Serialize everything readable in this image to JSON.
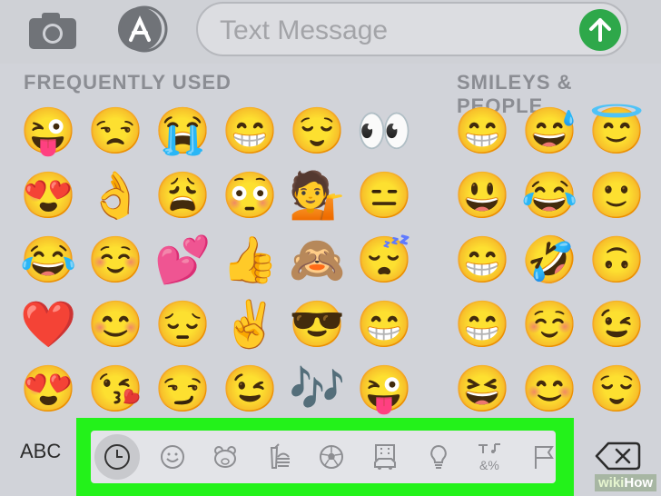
{
  "composer": {
    "placeholder": "Text Message",
    "send_color": "#2ea84a"
  },
  "sections": {
    "frequently_used": "FREQUENTLY USED",
    "smileys_people": "SMILEYS & PEOPLE"
  },
  "keyboard": {
    "abc_label": "ABC",
    "categories": [
      {
        "name": "recent-icon",
        "selected": true
      },
      {
        "name": "smiley-icon",
        "selected": false
      },
      {
        "name": "animal-icon",
        "selected": false
      },
      {
        "name": "food-icon",
        "selected": false
      },
      {
        "name": "activity-icon",
        "selected": false
      },
      {
        "name": "travel-icon",
        "selected": false
      },
      {
        "name": "objects-icon",
        "selected": false
      },
      {
        "name": "symbols-icon",
        "selected": false
      },
      {
        "name": "flag-icon",
        "selected": false
      }
    ],
    "symbols_label": "&%",
    "highlight_color": "#23f21a"
  },
  "emoji_rows": [
    [
      "😜",
      "😒",
      "😭",
      "😁",
      "😌",
      "👀",
      "",
      "😁",
      "😅",
      "😇"
    ],
    [
      "😍",
      "👌",
      "😩",
      "😳",
      "💁",
      "😑",
      "",
      "😃",
      "😂",
      "🙂"
    ],
    [
      "😂",
      "☺️",
      "💕",
      "👍",
      "🙈",
      "😴",
      "",
      "😁",
      "🤣",
      "🙃"
    ],
    [
      "❤️",
      "😊",
      "😔",
      "✌️",
      "😎",
      "😁",
      "",
      "😁",
      "☺️",
      "😉"
    ],
    [
      "😍",
      "😘",
      "😏",
      "😉",
      "🎶",
      "😜",
      "",
      "😆",
      "😊",
      "😌"
    ]
  ],
  "watermark": {
    "wiki": "wiki",
    "how": "How"
  }
}
